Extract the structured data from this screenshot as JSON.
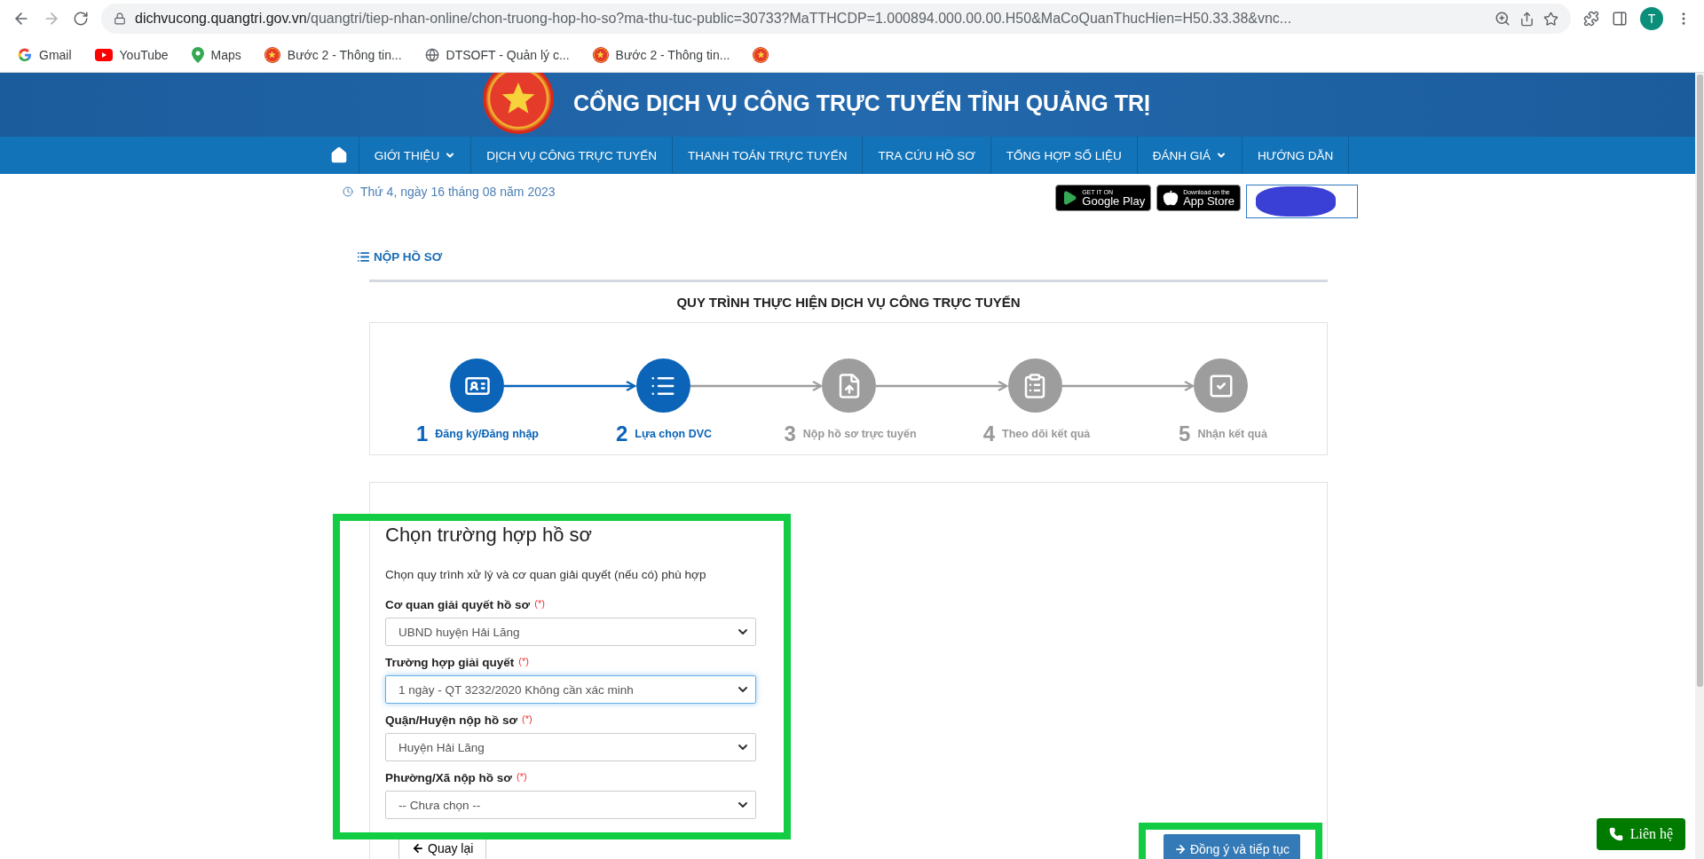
{
  "browser": {
    "url_host": "dichvucong.quangtri.gov.vn",
    "url_path": "/quangtri/tiep-nhan-online/chon-truong-hop-ho-so?ma-thu-tuc-public=30733?MaTTHCDP=1.000894.000.00.00.H50&MaCoQuanThucHien=H50.33.38&vnc...",
    "profile_initial": "T",
    "bookmarks": [
      {
        "label": "Gmail",
        "kind": "gmail"
      },
      {
        "label": "YouTube",
        "kind": "youtube"
      },
      {
        "label": "Maps",
        "kind": "maps"
      },
      {
        "label": "Bước 2 - Thông tin...",
        "kind": "emblem"
      },
      {
        "label": "DTSOFT - Quản lý c...",
        "kind": "globe"
      },
      {
        "label": "Bước 2 - Thông tin...",
        "kind": "emblem"
      },
      {
        "kind": "emblem"
      }
    ]
  },
  "header": {
    "title": "CỔNG DỊCH VỤ CÔNG TRỰC TUYẾN TỈNH QUẢNG TRỊ"
  },
  "nav": [
    {
      "label": "GIỚI THIỆU",
      "dropdown": true
    },
    {
      "label": "DỊCH VỤ CÔNG TRỰC TUYẾN",
      "dropdown": false
    },
    {
      "label": "THANH TOÁN TRỰC TUYẾN",
      "dropdown": false
    },
    {
      "label": "TRA CỨU HỒ SƠ",
      "dropdown": false
    },
    {
      "label": "TỔNG HỢP SỐ LIỆU",
      "dropdown": false
    },
    {
      "label": "ĐÁNH GIÁ",
      "dropdown": true
    },
    {
      "label": "HƯỚNG DẪN",
      "dropdown": false
    }
  ],
  "date": "Thứ 4, ngày 16 tháng 08 năm 2023",
  "badges": [
    {
      "kind": "google",
      "small": "GET IT ON",
      "big": "Google Play"
    },
    {
      "kind": "apple",
      "small": "Download on the",
      "big": "App Store"
    }
  ],
  "section_title": "NỘP HỒ SƠ",
  "process": {
    "title": "QUY TRÌNH THỰC HIỆN DỊCH VỤ CÔNG TRỰC TUYẾN",
    "steps": [
      {
        "number": "1",
        "label": "Đăng ký/Đăng nhập",
        "completed": true
      },
      {
        "number": "2",
        "label": "Lựa chọn DVC",
        "completed": true
      },
      {
        "number": "3",
        "label": "Nộp hồ sơ trực tuyến",
        "completed": false
      },
      {
        "number": "4",
        "label": "Theo dõi kết quả",
        "completed": false
      },
      {
        "number": "5",
        "label": "Nhận kết quả",
        "completed": false
      }
    ]
  },
  "form": {
    "title": "Chọn trường hợp hồ sơ",
    "subtitle": "Chọn quy trình xử lý và cơ quan giải quyết (nếu có) phù hợp",
    "fields": [
      {
        "label": "Cơ quan giải quyết hồ sơ",
        "required_mark": "(*)",
        "value": "UBND huyện Hải Lăng",
        "focused": false
      },
      {
        "label": "Trường hợp giải quyết",
        "required_mark": "(*)",
        "value": "1 ngày - QT 3232/2020 Không cần xác minh",
        "focused": true
      },
      {
        "label": "Quận/Huyện nộp hồ sơ",
        "required_mark": "(*)",
        "value": "Huyện Hải Lăng",
        "focused": false
      },
      {
        "label": "Phường/Xã nộp hồ sơ",
        "required_mark": "(*)",
        "value": "-- Chưa chọn --",
        "focused": false
      }
    ],
    "back_button": "Quay lại",
    "next_button": "Đồng ý và tiếp tục"
  },
  "contact_button": "Liên hệ"
}
